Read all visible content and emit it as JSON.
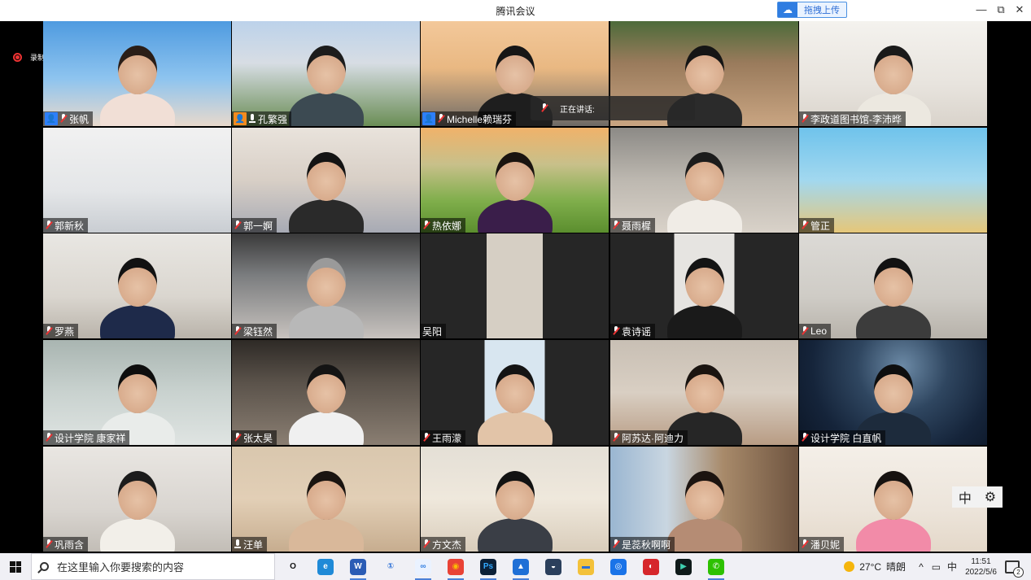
{
  "window": {
    "title": "腾讯会议",
    "cloud_upload_label": "拖拽上传",
    "minimize": "—",
    "restore": "⧉",
    "close": "✕"
  },
  "recording": {
    "label": "录制中"
  },
  "speaking": {
    "label": "正在讲话:"
  },
  "side_control": {
    "ime": "中",
    "settings_icon": "⚙"
  },
  "participants": [
    {
      "name": "张帆",
      "host": "person-icon",
      "host_color": "#2d7ff9",
      "mic": "muted",
      "bg": "linear-gradient(180deg,#4f9be0 0%,#8ec4ef 55%,#e8d9cc 100%)",
      "body": "#f1dfd6",
      "hair": "#2a1e18"
    },
    {
      "name": "孔繁强",
      "host": "person-icon",
      "host_color": "#f28b1e",
      "mic": "on",
      "bg": "linear-gradient(180deg,#bcd2ea 0%,#d7dde4 40%,#6a8d55 100%)",
      "body": "#3c4a52",
      "hair": "#1c1c1c"
    },
    {
      "name": "Michelle赖瑞芬",
      "host": "person-icon",
      "host_color": "#2d7ff9",
      "mic": "muted",
      "bg": "linear-gradient(180deg,#f3c89a 0%,#e9b882 45%,#6e6a66 100%)",
      "body": "#1e1e1e",
      "hair": "#161616"
    },
    {
      "name": "",
      "host": "",
      "host_color": "",
      "mic": "none",
      "bg": "linear-gradient(180deg,#4d6b3a 0%,#9a7b5c 40%,#c9a582 100%)",
      "body": "#2b2b2b",
      "hair": "#151515"
    },
    {
      "name": "李政道图书馆-李沛晔",
      "host": "",
      "host_color": "",
      "mic": "muted",
      "bg": "linear-gradient(180deg,#f4f2ee 0%,#e8e4de 60%,#d9d3cb 100%)",
      "body": "#ece8e0",
      "hair": "#1a1a1a"
    },
    {
      "name": "郭新秋",
      "host": "",
      "host_color": "",
      "mic": "muted",
      "bg": "linear-gradient(180deg,#f1f1f1 0%,#e4e6e8 60%,#c9cdd2 100%)",
      "body": "",
      "hair": ""
    },
    {
      "name": "郭一婀",
      "host": "",
      "host_color": "",
      "mic": "muted",
      "bg": "linear-gradient(180deg,#e9e3dc 0%,#d8cfc6 50%,#a7aab4 100%)",
      "body": "#2a2a2a",
      "hair": "#141414"
    },
    {
      "name": "热依娜",
      "host": "",
      "host_color": "",
      "mic": "muted",
      "bg": "linear-gradient(180deg,#f0b26a 0%,#c8c08a 35%,#7fae4b 70%,#5b8e2e 100%)",
      "body": "#3a1e4a",
      "hair": "#1a1410"
    },
    {
      "name": "聂雨樨",
      "host": "",
      "host_color": "",
      "mic": "muted",
      "bg": "linear-gradient(180deg,#8c8a86 0%,#bdb8b0 50%,#d9d2c9 100%)",
      "body": "#f0ece6",
      "hair": "#1c1c1c"
    },
    {
      "name": "管正",
      "host": "",
      "host_color": "",
      "mic": "muted",
      "bg": "linear-gradient(180deg,#6fc3ec 0%,#a2d8ef 50%,#e6c779 100%)",
      "body": "",
      "hair": ""
    },
    {
      "name": "罗燕",
      "host": "",
      "host_color": "",
      "mic": "muted",
      "bg": "linear-gradient(180deg,#e9e7e3 0%,#dad6cf 60%,#b9b3aa 100%)",
      "body": "#1e2a4a",
      "hair": "#121212"
    },
    {
      "name": "梁钰然",
      "host": "",
      "host_color": "",
      "mic": "muted",
      "bg": "linear-gradient(180deg,#3a3a3a 0%,#7b7d7f 40%,#c7c2be 100%)",
      "body": "#b8b8b8",
      "hair": "#9a9a9a"
    },
    {
      "name": "吴阳",
      "host": "",
      "host_color": "",
      "mic": "none",
      "bg": "linear-gradient(90deg,#262626 0%,#262626 35%,#d6cfc4 35%,#d6cfc4 65%,#262626 65%)",
      "body": "",
      "hair": ""
    },
    {
      "name": "袁诗谣",
      "host": "",
      "host_color": "",
      "mic": "muted",
      "bg": "linear-gradient(90deg,#262626 0%,#262626 34%,#e6e4e1 34%,#e6e4e1 66%,#262626 66%)",
      "body": "#1a1a1a",
      "hair": "#141414"
    },
    {
      "name": "Leo",
      "host": "",
      "host_color": "",
      "mic": "muted",
      "bg": "linear-gradient(180deg,#dcdad6 0%,#cfccc6 60%,#b7b2aa 100%)",
      "body": "#3c3c3c",
      "hair": "#121212"
    },
    {
      "name": "设计学院 康家祥",
      "host": "",
      "host_color": "",
      "mic": "muted",
      "bg": "linear-gradient(180deg,#a9b5b1 0%,#c9d2cf 50%,#dfe4e2 100%)",
      "body": "#e9ecea",
      "hair": "#0e0e0e"
    },
    {
      "name": "张太昊",
      "host": "",
      "host_color": "",
      "mic": "muted",
      "bg": "linear-gradient(180deg,#2e2a26 0%,#5a524a 40%,#8a7e72 100%)",
      "body": "#f0f0f0",
      "hair": "#141414"
    },
    {
      "name": "王雨濛",
      "host": "",
      "host_color": "",
      "mic": "muted",
      "bg": "linear-gradient(90deg,#262626 0%,#262626 34%,#d8e6f0 34%,#d8e6f0 66%,#262626 66%)",
      "body": "#e2c4a8",
      "hair": "#141414"
    },
    {
      "name": "阿苏达·阿迪力",
      "host": "",
      "host_color": "",
      "mic": "muted",
      "bg": "linear-gradient(180deg,#c8bfb4 0%,#d9cfc3 50%,#b89c84 100%)",
      "body": "#262626",
      "hair": "#1a1410"
    },
    {
      "name": "设计学院 白直帆",
      "host": "",
      "host_color": "",
      "mic": "muted",
      "bg": "radial-gradient(circle at 55% 25%,#6c8aa6 0%,#2f4660 35%,#15243a 70%,#0c1626 100%)",
      "body": "#1d2b3c",
      "hair": "#0e0e0e"
    },
    {
      "name": "巩雨含",
      "host": "",
      "host_color": "",
      "mic": "muted",
      "bg": "linear-gradient(180deg,#e9e6e2 0%,#d9d5d0 60%,#c2bdb6 100%)",
      "body": "#f2efe9",
      "hair": "#1c1c1c"
    },
    {
      "name": "汪单",
      "host": "",
      "host_color": "",
      "mic": "on",
      "bg": "linear-gradient(180deg,#d9c7ae 0%,#e2cfb6 50%,#c7ad8f 100%)",
      "body": "#d9b89a",
      "hair": "#1a1410"
    },
    {
      "name": "方文杰",
      "host": "",
      "host_color": "",
      "mic": "muted",
      "bg": "linear-gradient(180deg,#e4dfd6 0%,#efe8dc 50%,#d9cdbb 100%)",
      "body": "#3a3e46",
      "hair": "#121212"
    },
    {
      "name": "是蕊秋啊啊",
      "host": "",
      "host_color": "",
      "mic": "muted",
      "bg": "linear-gradient(90deg,#9ab6d1 0%,#c9d6e1 30%,#a88a6a 60%,#6e5440 100%)",
      "body": "#b58c74",
      "hair": "#1c1410"
    },
    {
      "name": "潘贝妮",
      "host": "",
      "host_color": "",
      "mic": "muted",
      "bg": "linear-gradient(180deg,#f4efe8 0%,#ece4da 60%,#e4d8c9 100%)",
      "body": "#f28ba8",
      "hair": "#161210"
    }
  ],
  "taskbar": {
    "search_placeholder": "在这里输入你要搜索的内容",
    "apps": [
      {
        "name": "task-view-icon",
        "glyph": "O",
        "color": "transparent",
        "text": "#111"
      },
      {
        "name": "edge-icon",
        "glyph": "e",
        "color": "#1f8ad7",
        "text": "#fff"
      },
      {
        "name": "word-icon",
        "glyph": "W",
        "color": "#2b5cb5",
        "text": "#fff"
      },
      {
        "name": "onenote-icon",
        "glyph": "①",
        "color": "transparent",
        "text": "#2b6fd6"
      },
      {
        "name": "tencent-meeting-icon",
        "glyph": "∞",
        "color": "#eaf2ff",
        "text": "#2f7de1"
      },
      {
        "name": "chrome-icon",
        "glyph": "◉",
        "color": "#e94235",
        "text": "#fbbc04"
      },
      {
        "name": "photoshop-icon",
        "glyph": "Ps",
        "color": "#0b2038",
        "text": "#31a8ff"
      },
      {
        "name": "cloud-app-icon",
        "glyph": "▲",
        "color": "#1f6fd6",
        "text": "#fff"
      },
      {
        "name": "network-icon",
        "glyph": "◒",
        "color": "#2b3f5c",
        "text": "#fff"
      },
      {
        "name": "file-explorer-icon",
        "glyph": "▬",
        "color": "#f3c13a",
        "text": "#2b6fd6"
      },
      {
        "name": "dingtalk-icon",
        "glyph": "◎",
        "color": "#1a73e8",
        "text": "#fff"
      },
      {
        "name": "netease-music-icon",
        "glyph": "◐",
        "color": "#d6262b",
        "text": "#fff"
      },
      {
        "name": "capcut-icon",
        "glyph": "▶",
        "color": "#0f1a1a",
        "text": "#3fd0b0"
      },
      {
        "name": "wechat-icon",
        "glyph": "✆",
        "color": "#2dc100",
        "text": "#fff"
      }
    ],
    "weather_temp": "27°C",
    "weather_text": "晴朗",
    "tray_caret": "^",
    "tray_battery": "▭",
    "ime": "中",
    "time": "11:51",
    "date": "2022/5/6",
    "notif_count": "2"
  }
}
